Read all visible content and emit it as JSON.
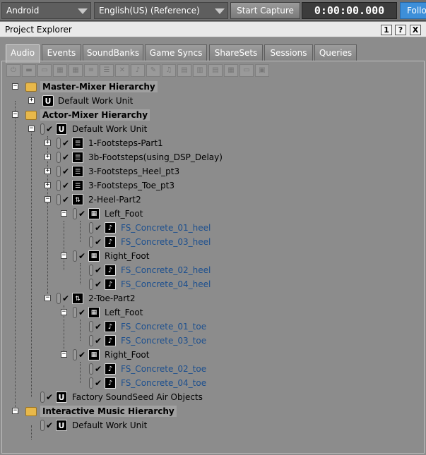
{
  "topbar": {
    "platform": "Android",
    "language": "English(US) (Reference)",
    "start_capture": "Start Capture",
    "timer": "0:00:00.000",
    "follow": "Follo"
  },
  "panel": {
    "title": "Project Explorer",
    "btn_one": "1",
    "btn_help": "?",
    "btn_close": "X"
  },
  "tabs": [
    "Audio",
    "Events",
    "SoundBanks",
    "Game Syncs",
    "ShareSets",
    "Sessions",
    "Queries"
  ],
  "tree": {
    "master_mixer": "Master-Mixer Hierarchy",
    "master_default": "Default Work Unit",
    "actor_mixer": "Actor-Mixer Hierarchy",
    "actor_default": "Default Work Unit",
    "fs_part1": "1-Footsteps-Part1",
    "fs_dsp": "3b-Footsteps(using_DSP_Delay)",
    "fs_heel": "3-Footsteps_Heel_pt3",
    "fs_toe": "3-Footsteps_Toe_pt3",
    "heel_part2": "2-Heel-Part2",
    "heel_left": "Left_Foot",
    "heel_left_1": "FS_Concrete_01_heel",
    "heel_left_2": "FS_Concrete_03_heel",
    "heel_right": "Right_Foot",
    "heel_right_1": "FS_Concrete_02_heel",
    "heel_right_2": "FS_Concrete_04_heel",
    "toe_part2": "2-Toe-Part2",
    "toe_left": "Left_Foot",
    "toe_left_1": "FS_Concrete_01_toe",
    "toe_left_2": "FS_Concrete_03_toe",
    "toe_right": "Right_Foot",
    "toe_right_1": "FS_Concrete_02_toe",
    "toe_right_2": "FS_Concrete_04_toe",
    "factory": "Factory SoundSeed Air Objects",
    "interactive": "Interactive Music Hierarchy",
    "interactive_default": "Default Work Unit"
  },
  "colors": {
    "link_blue": "#1c4f8e",
    "follow_blue": "#3d8fd9",
    "folder": "#e8b84a"
  }
}
